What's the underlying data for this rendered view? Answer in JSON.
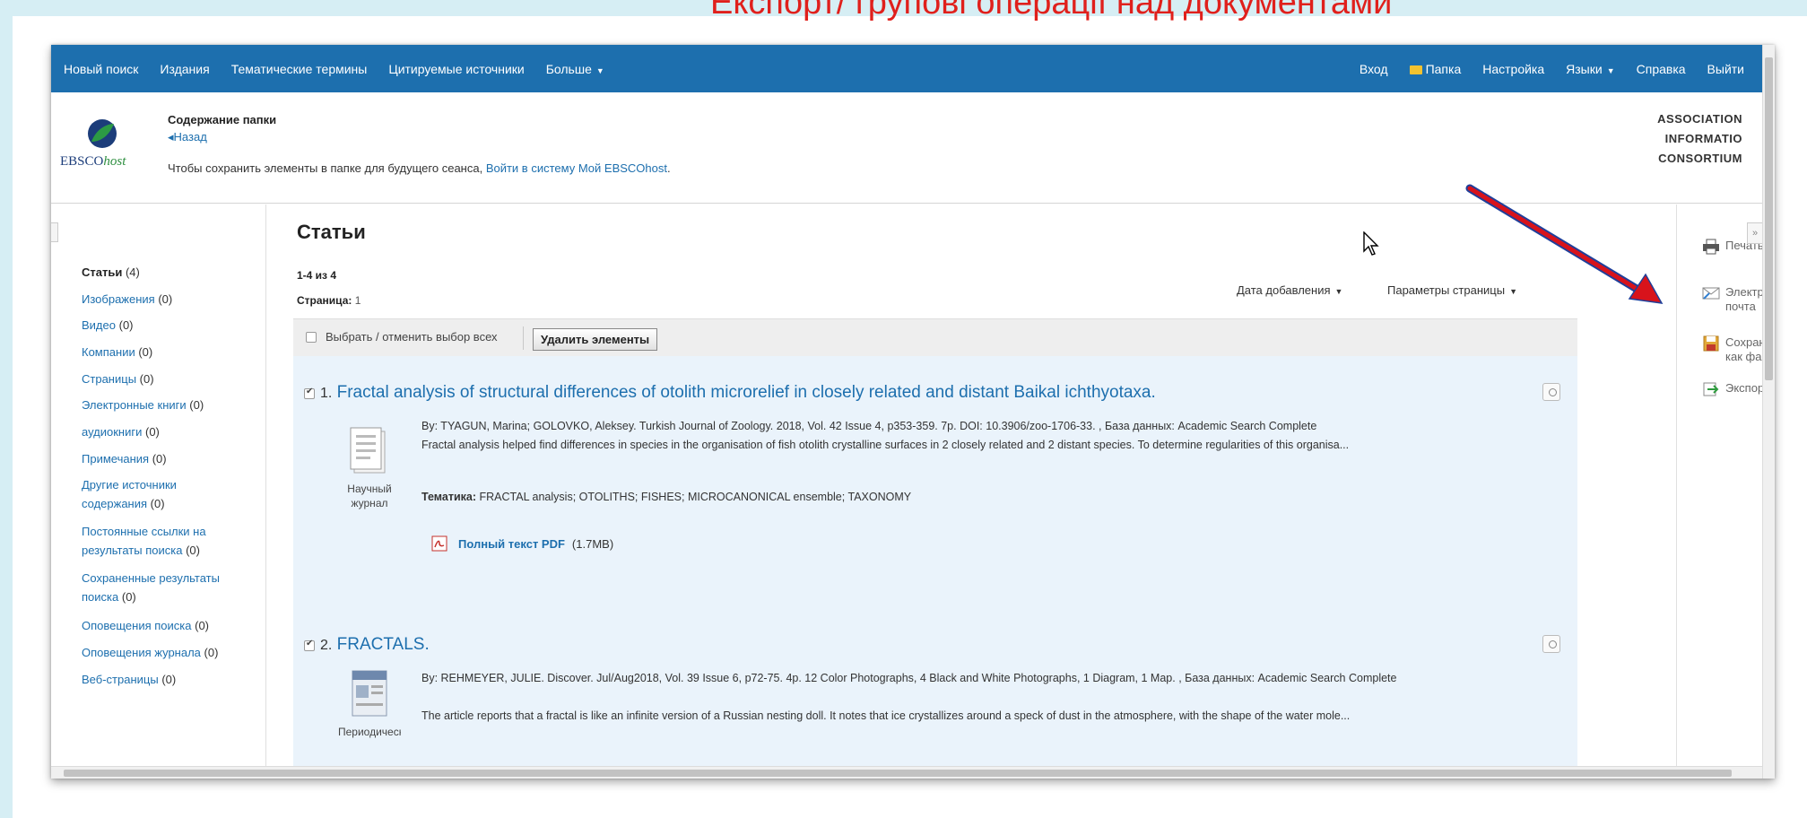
{
  "slide": {
    "title": "Експорт/ групові операції над документами"
  },
  "topnav": {
    "left": [
      "Новый поиск",
      "Издания",
      "Тематические термины",
      "Цитируемые источники",
      "Больше"
    ],
    "right": [
      "Вход",
      "Папка",
      "Настройка",
      "Языки",
      "Справка",
      "Выйти"
    ]
  },
  "header": {
    "folder_title": "Содержание папки",
    "back": "◂Назад",
    "save_note": "Чтобы сохранить элементы в папке для будущего сеанса, ",
    "save_link": "Войти в систему Мой EBSCOhost",
    "save_end": ".",
    "org_name": "ASSOCIATION INFORMATIO CONSORTIUM",
    "logo_text": "EBSCO",
    "logo_text_italic": "host"
  },
  "sidebar": {
    "items": [
      {
        "label": "Статьи",
        "count": "(4)"
      },
      {
        "label": "Изображения",
        "count": "(0)"
      },
      {
        "label": "Видео",
        "count": "(0)"
      },
      {
        "label": "Компании",
        "count": "(0)"
      },
      {
        "label": "Страницы",
        "count": "(0)"
      },
      {
        "label": "Электронные книги",
        "count": "(0)"
      },
      {
        "label": "аудиокниги",
        "count": "(0)"
      },
      {
        "label": "Примечания",
        "count": "(0)"
      },
      {
        "label": "Другие источники содержания",
        "count": "(0)"
      },
      {
        "label": "Постоянные ссылки на результаты поиска",
        "count": "(0)"
      },
      {
        "label": "Сохраненные результаты поиска",
        "count": "(0)"
      },
      {
        "label": "Оповещения поиска",
        "count": "(0)"
      },
      {
        "label": "Оповещения журнала",
        "count": "(0)"
      },
      {
        "label": "Веб-страницы",
        "count": "(0)"
      }
    ]
  },
  "main": {
    "title": "Статьи",
    "range": "1-4 из 4",
    "page_label": "Страница:",
    "page_value": "1",
    "sort_label": "Дата добавления",
    "page_options": "Параметры страницы",
    "select_all": "Выбрать / отменить выбор всех",
    "delete_button": "Удалить элементы"
  },
  "results": [
    {
      "num": "1.",
      "title": "Fractal analysis of structural differences of otolith microrelief in closely related and distant Baikal ichthyotaxa.",
      "type": "Научный журнал",
      "meta": "By: TYAGUN, Marina; GOLOVKO, Aleksey. Turkish Journal of Zoology. 2018, Vol. 42 Issue 4, p353-359. 7p. DOI: 10.3906/zoo-1706-33. , База данных: Academic Search Complete",
      "abstract": "Fractal analysis helped find differences in species in the organisation of fish otolith crystalline surfaces in 2 closely related and 2 distant species. To determine regularities of this organisa...",
      "subject_label": "Тематика:",
      "subjects": "FRACTAL analysis; OTOLITHS; FISHES; MICROCANONICAL ensemble; TAXONOMY",
      "pdf_label": "Полный текст PDF",
      "pdf_size": "(1.7MB)"
    },
    {
      "num": "2.",
      "title": "FRACTALS.",
      "type": "Периодическое издание",
      "meta": "By: REHMEYER, JULIE. Discover. Jul/Aug2018, Vol. 39 Issue 6, p72-75. 4p. 12 Color Photographs, 4 Black and White Photographs, 1 Diagram, 1 Map. , База данных: Academic Search Complete",
      "abstract": "The article reports that a fractal is like an infinite version of a Russian nesting doll. It notes that ice crystallizes around a speck of dust in the atmosphere, with the shape of the water mole..."
    }
  ],
  "tools": [
    {
      "label": "Печать",
      "icon": "print-icon"
    },
    {
      "label": "Электронная почта",
      "icon": "email-icon"
    },
    {
      "label": "Сохранить как файл",
      "icon": "save-icon"
    },
    {
      "label": "Экспортировать",
      "icon": "export-icon"
    }
  ],
  "colors": {
    "nav_bg": "#1d6fae",
    "link": "#1d6fae",
    "result_bg": "#eaf3fb",
    "title_red": "#e0201c",
    "arrow_red": "#d8131b",
    "arrow_blue": "#1f3f9a"
  }
}
